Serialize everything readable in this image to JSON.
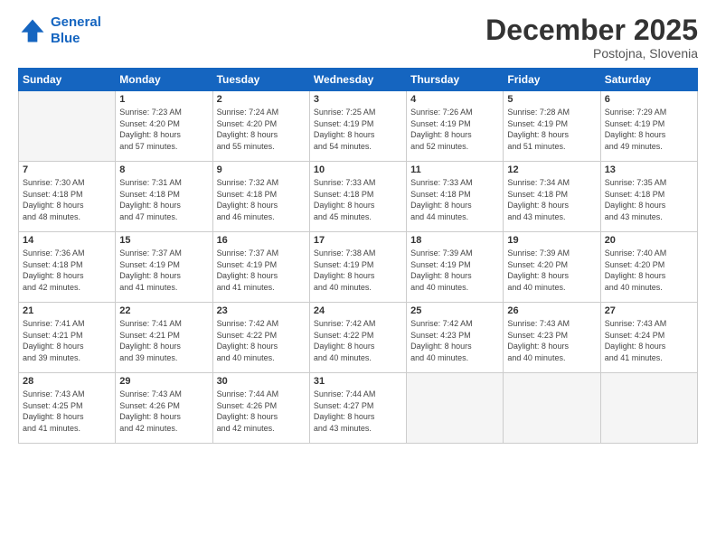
{
  "header": {
    "logo_line1": "General",
    "logo_line2": "Blue",
    "main_title": "December 2025",
    "subtitle": "Postojna, Slovenia"
  },
  "weekdays": [
    "Sunday",
    "Monday",
    "Tuesday",
    "Wednesday",
    "Thursday",
    "Friday",
    "Saturday"
  ],
  "weeks": [
    [
      {
        "day": "",
        "info": ""
      },
      {
        "day": "1",
        "info": "Sunrise: 7:23 AM\nSunset: 4:20 PM\nDaylight: 8 hours\nand 57 minutes."
      },
      {
        "day": "2",
        "info": "Sunrise: 7:24 AM\nSunset: 4:20 PM\nDaylight: 8 hours\nand 55 minutes."
      },
      {
        "day": "3",
        "info": "Sunrise: 7:25 AM\nSunset: 4:19 PM\nDaylight: 8 hours\nand 54 minutes."
      },
      {
        "day": "4",
        "info": "Sunrise: 7:26 AM\nSunset: 4:19 PM\nDaylight: 8 hours\nand 52 minutes."
      },
      {
        "day": "5",
        "info": "Sunrise: 7:28 AM\nSunset: 4:19 PM\nDaylight: 8 hours\nand 51 minutes."
      },
      {
        "day": "6",
        "info": "Sunrise: 7:29 AM\nSunset: 4:19 PM\nDaylight: 8 hours\nand 49 minutes."
      }
    ],
    [
      {
        "day": "7",
        "info": "Sunrise: 7:30 AM\nSunset: 4:18 PM\nDaylight: 8 hours\nand 48 minutes."
      },
      {
        "day": "8",
        "info": "Sunrise: 7:31 AM\nSunset: 4:18 PM\nDaylight: 8 hours\nand 47 minutes."
      },
      {
        "day": "9",
        "info": "Sunrise: 7:32 AM\nSunset: 4:18 PM\nDaylight: 8 hours\nand 46 minutes."
      },
      {
        "day": "10",
        "info": "Sunrise: 7:33 AM\nSunset: 4:18 PM\nDaylight: 8 hours\nand 45 minutes."
      },
      {
        "day": "11",
        "info": "Sunrise: 7:33 AM\nSunset: 4:18 PM\nDaylight: 8 hours\nand 44 minutes."
      },
      {
        "day": "12",
        "info": "Sunrise: 7:34 AM\nSunset: 4:18 PM\nDaylight: 8 hours\nand 43 minutes."
      },
      {
        "day": "13",
        "info": "Sunrise: 7:35 AM\nSunset: 4:18 PM\nDaylight: 8 hours\nand 43 minutes."
      }
    ],
    [
      {
        "day": "14",
        "info": "Sunrise: 7:36 AM\nSunset: 4:18 PM\nDaylight: 8 hours\nand 42 minutes."
      },
      {
        "day": "15",
        "info": "Sunrise: 7:37 AM\nSunset: 4:19 PM\nDaylight: 8 hours\nand 41 minutes."
      },
      {
        "day": "16",
        "info": "Sunrise: 7:37 AM\nSunset: 4:19 PM\nDaylight: 8 hours\nand 41 minutes."
      },
      {
        "day": "17",
        "info": "Sunrise: 7:38 AM\nSunset: 4:19 PM\nDaylight: 8 hours\nand 40 minutes."
      },
      {
        "day": "18",
        "info": "Sunrise: 7:39 AM\nSunset: 4:19 PM\nDaylight: 8 hours\nand 40 minutes."
      },
      {
        "day": "19",
        "info": "Sunrise: 7:39 AM\nSunset: 4:20 PM\nDaylight: 8 hours\nand 40 minutes."
      },
      {
        "day": "20",
        "info": "Sunrise: 7:40 AM\nSunset: 4:20 PM\nDaylight: 8 hours\nand 40 minutes."
      }
    ],
    [
      {
        "day": "21",
        "info": "Sunrise: 7:41 AM\nSunset: 4:21 PM\nDaylight: 8 hours\nand 39 minutes."
      },
      {
        "day": "22",
        "info": "Sunrise: 7:41 AM\nSunset: 4:21 PM\nDaylight: 8 hours\nand 39 minutes."
      },
      {
        "day": "23",
        "info": "Sunrise: 7:42 AM\nSunset: 4:22 PM\nDaylight: 8 hours\nand 40 minutes."
      },
      {
        "day": "24",
        "info": "Sunrise: 7:42 AM\nSunset: 4:22 PM\nDaylight: 8 hours\nand 40 minutes."
      },
      {
        "day": "25",
        "info": "Sunrise: 7:42 AM\nSunset: 4:23 PM\nDaylight: 8 hours\nand 40 minutes."
      },
      {
        "day": "26",
        "info": "Sunrise: 7:43 AM\nSunset: 4:23 PM\nDaylight: 8 hours\nand 40 minutes."
      },
      {
        "day": "27",
        "info": "Sunrise: 7:43 AM\nSunset: 4:24 PM\nDaylight: 8 hours\nand 41 minutes."
      }
    ],
    [
      {
        "day": "28",
        "info": "Sunrise: 7:43 AM\nSunset: 4:25 PM\nDaylight: 8 hours\nand 41 minutes."
      },
      {
        "day": "29",
        "info": "Sunrise: 7:43 AM\nSunset: 4:26 PM\nDaylight: 8 hours\nand 42 minutes."
      },
      {
        "day": "30",
        "info": "Sunrise: 7:44 AM\nSunset: 4:26 PM\nDaylight: 8 hours\nand 42 minutes."
      },
      {
        "day": "31",
        "info": "Sunrise: 7:44 AM\nSunset: 4:27 PM\nDaylight: 8 hours\nand 43 minutes."
      },
      {
        "day": "",
        "info": ""
      },
      {
        "day": "",
        "info": ""
      },
      {
        "day": "",
        "info": ""
      }
    ]
  ]
}
